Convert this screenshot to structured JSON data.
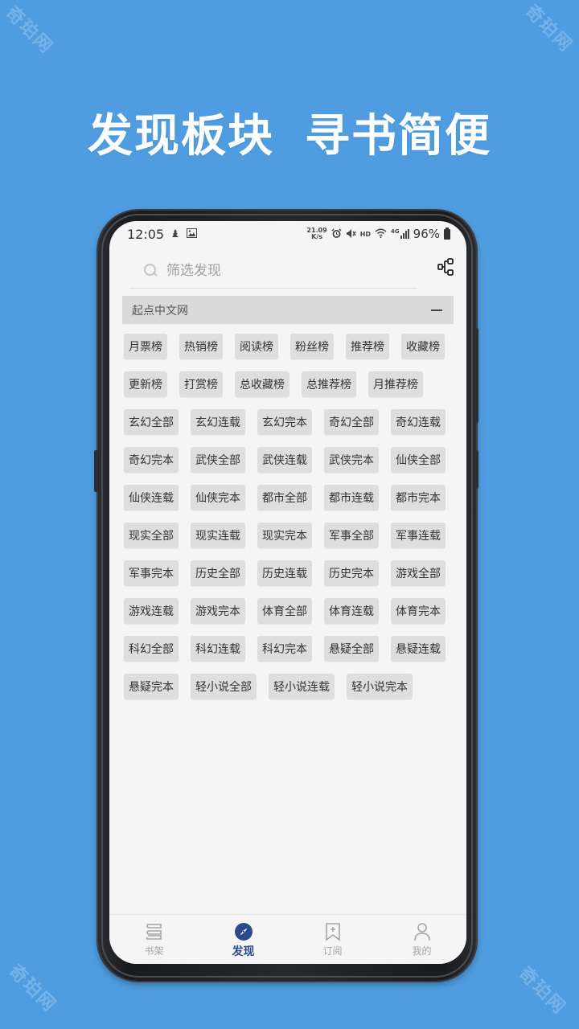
{
  "watermark": "奇珀网",
  "headline": {
    "part1": "发现板块",
    "part2": "寻书简便"
  },
  "status_bar": {
    "time": "12:05",
    "net_speed_value": "21.09",
    "net_speed_unit": "K/s",
    "hd": "HD",
    "network": "4G",
    "battery": "96%"
  },
  "search": {
    "placeholder": "筛选发现"
  },
  "section": {
    "title": "起点中文网",
    "collapse": "−"
  },
  "chip_rows": [
    [
      "月票榜",
      "热销榜",
      "阅读榜",
      "粉丝榜",
      "推荐榜",
      "收藏榜"
    ],
    [
      "更新榜",
      "打赏榜",
      "总收藏榜",
      "总推荐榜",
      "月推荐榜"
    ],
    [
      "玄幻全部",
      "玄幻连载",
      "玄幻完本",
      "奇幻全部",
      "奇幻连载"
    ],
    [
      "奇幻完本",
      "武侠全部",
      "武侠连载",
      "武侠完本",
      "仙侠全部"
    ],
    [
      "仙侠连载",
      "仙侠完本",
      "都市全部",
      "都市连载",
      "都市完本"
    ],
    [
      "现实全部",
      "现实连载",
      "现实完本",
      "军事全部",
      "军事连载"
    ],
    [
      "军事完本",
      "历史全部",
      "历史连载",
      "历史完本",
      "游戏全部"
    ],
    [
      "游戏连载",
      "游戏完本",
      "体育全部",
      "体育连载",
      "体育完本"
    ],
    [
      "科幻全部",
      "科幻连载",
      "科幻完本",
      "悬疑全部",
      "悬疑连载"
    ],
    [
      "悬疑完本",
      "轻小说全部",
      "轻小说连载",
      "轻小说完本"
    ]
  ],
  "bottom_nav": {
    "items": [
      {
        "label": "书架",
        "icon": "bookshelf-icon",
        "active": false
      },
      {
        "label": "发现",
        "icon": "compass-icon",
        "active": true
      },
      {
        "label": "订阅",
        "icon": "bookmark-add-icon",
        "active": false
      },
      {
        "label": "我的",
        "icon": "person-icon",
        "active": false
      }
    ]
  },
  "colors": {
    "background": "#4f9de0",
    "active_nav": "#2d4a8a",
    "chip": "#dedede",
    "section_header": "#dadada"
  }
}
